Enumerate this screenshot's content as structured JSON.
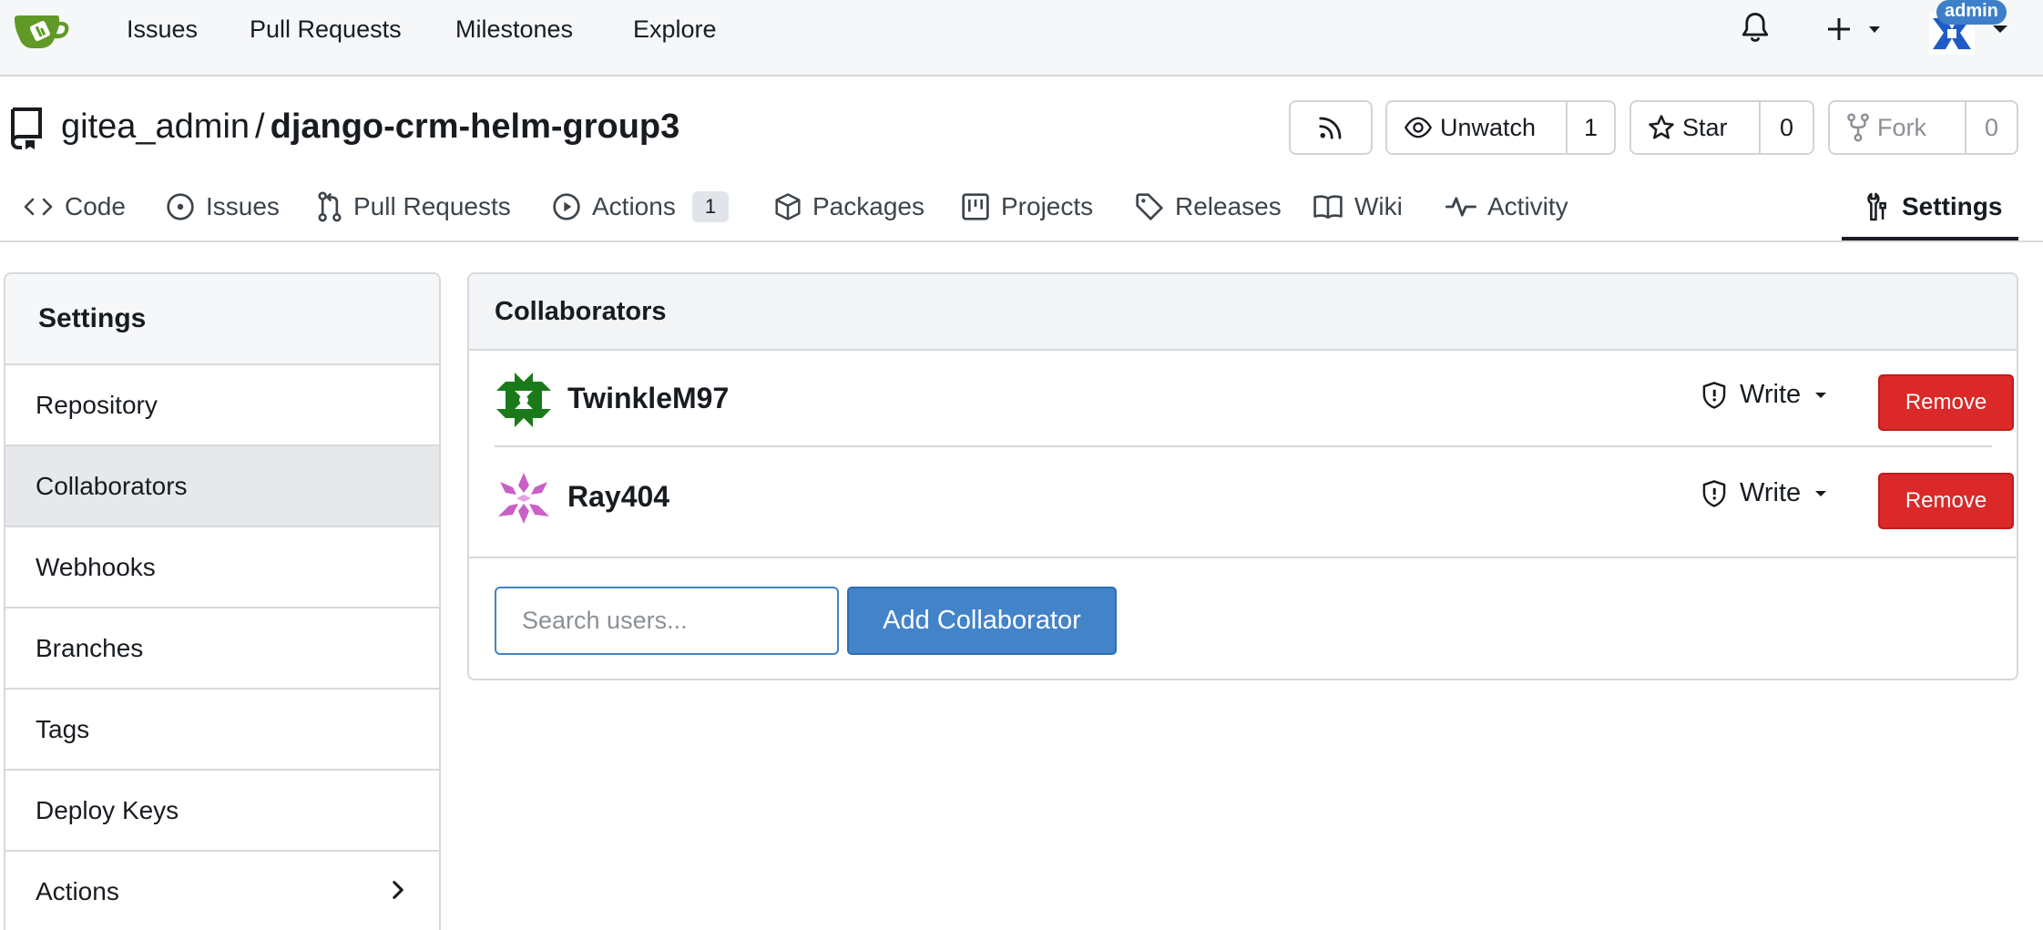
{
  "navbar": {
    "links": [
      "Issues",
      "Pull Requests",
      "Milestones",
      "Explore"
    ],
    "user_badge": "admin"
  },
  "repo": {
    "owner": "gitea_admin",
    "separator": "/",
    "name": "django-crm-helm-group3",
    "unwatch_label": "Unwatch",
    "watch_count": "1",
    "star_label": "Star",
    "star_count": "0",
    "fork_label": "Fork",
    "fork_count": "0"
  },
  "tabs": {
    "code": "Code",
    "issues": "Issues",
    "pull_requests": "Pull Requests",
    "actions": "Actions",
    "actions_count": "1",
    "packages": "Packages",
    "projects": "Projects",
    "releases": "Releases",
    "wiki": "Wiki",
    "activity": "Activity",
    "settings": "Settings"
  },
  "sidebar": {
    "title": "Settings",
    "items": [
      {
        "label": "Repository"
      },
      {
        "label": "Collaborators",
        "active": true
      },
      {
        "label": "Webhooks"
      },
      {
        "label": "Branches"
      },
      {
        "label": "Tags"
      },
      {
        "label": "Deploy Keys"
      },
      {
        "label": "Actions"
      }
    ]
  },
  "collaborators": {
    "title": "Collaborators",
    "rows": [
      {
        "username": "TwinkleM97",
        "permission": "Write",
        "remove_label": "Remove",
        "avatar_color": "#1a7a1a"
      },
      {
        "username": "Ray404",
        "permission": "Write",
        "remove_label": "Remove",
        "avatar_color": "#c95fc7"
      }
    ],
    "search_placeholder": "Search users...",
    "search_value": "",
    "add_label": "Add Collaborator"
  },
  "colors": {
    "danger": "#db2828",
    "primary": "#4383c8",
    "logo_green": "#609926"
  }
}
